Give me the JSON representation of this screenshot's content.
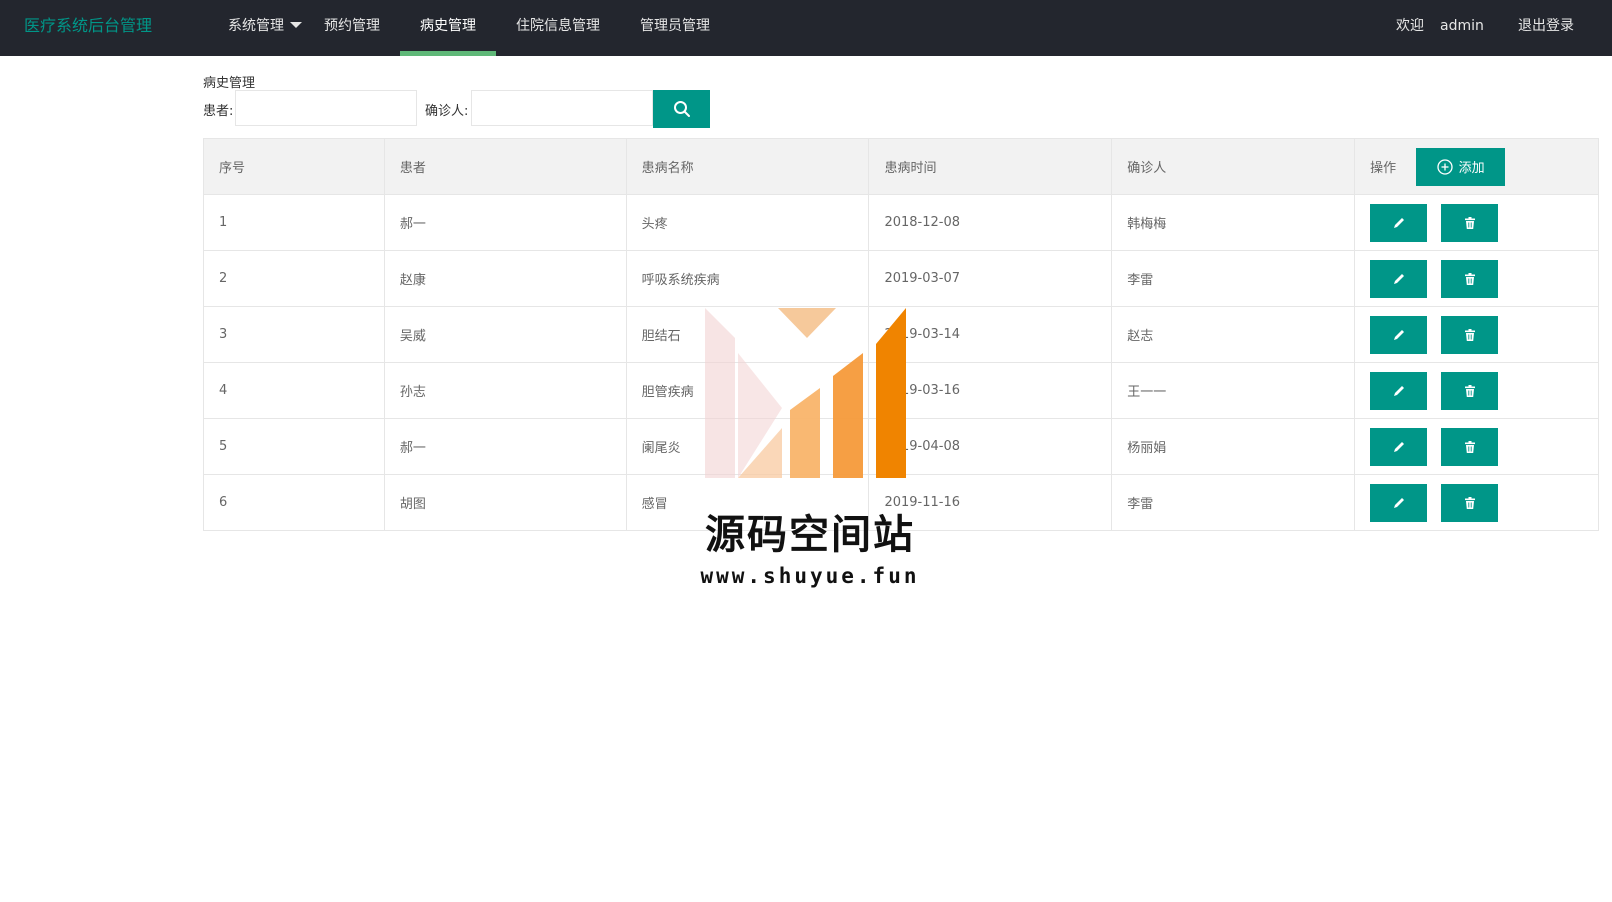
{
  "header": {
    "logo": "医疗系统后台管理",
    "nav": [
      "系统管理",
      "预约管理",
      "病史管理",
      "住院信息管理",
      "管理员管理"
    ],
    "active_nav": "病史管理",
    "welcome": "欢迎",
    "user": "admin",
    "logout": "退出登录"
  },
  "page": {
    "heading": "病史管理",
    "search": {
      "patient_label": "患者:",
      "patient_value": "",
      "doctor_label": "确诊人:",
      "doctor_value": ""
    }
  },
  "table": {
    "columns": [
      "序号",
      "患者",
      "患病名称",
      "患病时间",
      "确诊人",
      "操作"
    ],
    "add_label": "添加",
    "rows": [
      {
        "id": "1",
        "patient": "郝一",
        "disease": "头疼",
        "date": "2018-12-08",
        "doctor": "韩梅梅"
      },
      {
        "id": "2",
        "patient": "赵康",
        "disease": "呼吸系统疾病",
        "date": "2019-03-07",
        "doctor": "李雷"
      },
      {
        "id": "3",
        "patient": "吴威",
        "disease": "胆结石",
        "date": "2019-03-14",
        "doctor": "赵志"
      },
      {
        "id": "4",
        "patient": "孙志",
        "disease": "胆管疾病",
        "date": "2019-03-16",
        "doctor": "王一一"
      },
      {
        "id": "5",
        "patient": "郝一",
        "disease": "阑尾炎",
        "date": "2019-04-08",
        "doctor": "杨丽娟"
      },
      {
        "id": "6",
        "patient": "胡图",
        "disease": "感冒",
        "date": "2019-11-16",
        "doctor": "李雷"
      }
    ]
  },
  "watermark": {
    "title": "源码空间站",
    "url": "www.shuyue.fun"
  },
  "colors": {
    "topbar": "#23262e",
    "accent": "#009688",
    "nav_underline": "#5fb878",
    "table_header": "#f2f2f2"
  }
}
